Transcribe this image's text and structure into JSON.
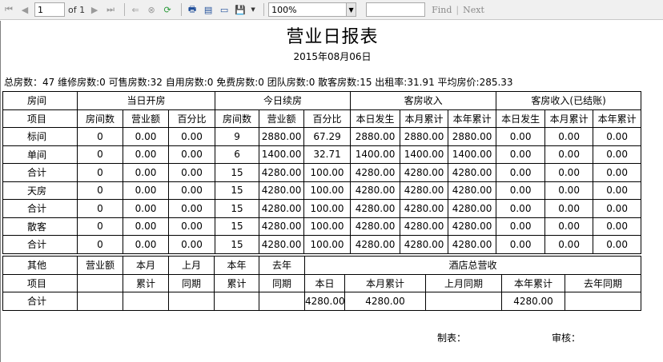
{
  "toolbar": {
    "page_number": "1",
    "page_of": "of 1",
    "zoom": "100%",
    "search_placeholder": "",
    "find_label": "Find",
    "separator": "|",
    "next_label": "Next"
  },
  "report": {
    "title": "营业日报表",
    "date": "2015年08月06日",
    "summary": "总房数：47 维修房数:0 可售房数:32 自用房数:0 免费房数:0 团队房数:0 散客房数:15 出租率:31.91 平均房价:285.33"
  },
  "table1": {
    "group_headers": [
      "房间",
      "当日开房",
      "今日续房",
      "客房收入",
      "客房收入(已结账)"
    ],
    "row_label_header": "项目",
    "sub_headers": [
      "房间数",
      "营业额",
      "百分比",
      "房间数",
      "营业额",
      "百分比",
      "本日发生",
      "本月累计",
      "本年累计",
      "本日发生",
      "本月累计",
      "本年累计"
    ],
    "rows": [
      {
        "label": "标间",
        "cells": [
          "0",
          "0.00",
          "0.00",
          "9",
          "2880.00",
          "67.29",
          "2880.00",
          "2880.00",
          "2880.00",
          "0.00",
          "0.00",
          "0.00"
        ]
      },
      {
        "label": "单间",
        "cells": [
          "0",
          "0.00",
          "0.00",
          "6",
          "1400.00",
          "32.71",
          "1400.00",
          "1400.00",
          "1400.00",
          "0.00",
          "0.00",
          "0.00"
        ]
      },
      {
        "label": "合计",
        "cells": [
          "0",
          "0.00",
          "0.00",
          "15",
          "4280.00",
          "100.00",
          "4280.00",
          "4280.00",
          "4280.00",
          "0.00",
          "0.00",
          "0.00"
        ]
      },
      {
        "label": "天房",
        "cells": [
          "0",
          "0.00",
          "0.00",
          "15",
          "4280.00",
          "100.00",
          "4280.00",
          "4280.00",
          "4280.00",
          "0.00",
          "0.00",
          "0.00"
        ]
      },
      {
        "label": "合计",
        "cells": [
          "0",
          "0.00",
          "0.00",
          "15",
          "4280.00",
          "100.00",
          "4280.00",
          "4280.00",
          "4280.00",
          "0.00",
          "0.00",
          "0.00"
        ]
      },
      {
        "label": "散客",
        "cells": [
          "0",
          "0.00",
          "0.00",
          "15",
          "4280.00",
          "100.00",
          "4280.00",
          "4280.00",
          "4280.00",
          "0.00",
          "0.00",
          "0.00"
        ]
      },
      {
        "label": "合计",
        "cells": [
          "0",
          "0.00",
          "0.00",
          "15",
          "4280.00",
          "100.00",
          "4280.00",
          "4280.00",
          "4280.00",
          "0.00",
          "0.00",
          "0.00"
        ]
      }
    ]
  },
  "table2": {
    "col1_top": "其他",
    "col1_bottom": "项目",
    "revenue": "营业额",
    "month_top": "本月",
    "month_bottom": "累计",
    "lastmonth_top": "上月",
    "lastmonth_bottom": "同期",
    "year_top": "本年",
    "year_bottom": "累计",
    "lastyear_top": "去年",
    "lastyear_bottom": "同期",
    "hotel_total": "酒店总营收",
    "hotel_sub": [
      "本日",
      "本月累计",
      "上月同期",
      "本年累计",
      "去年同期"
    ],
    "total_label": "合计",
    "total_cells": [
      "",
      "",
      "",
      "",
      "",
      "4280.00",
      "4280.00",
      "",
      "4280.00",
      ""
    ]
  },
  "footer": {
    "prepared_by": "制表：",
    "reviewed_by": "审核："
  }
}
